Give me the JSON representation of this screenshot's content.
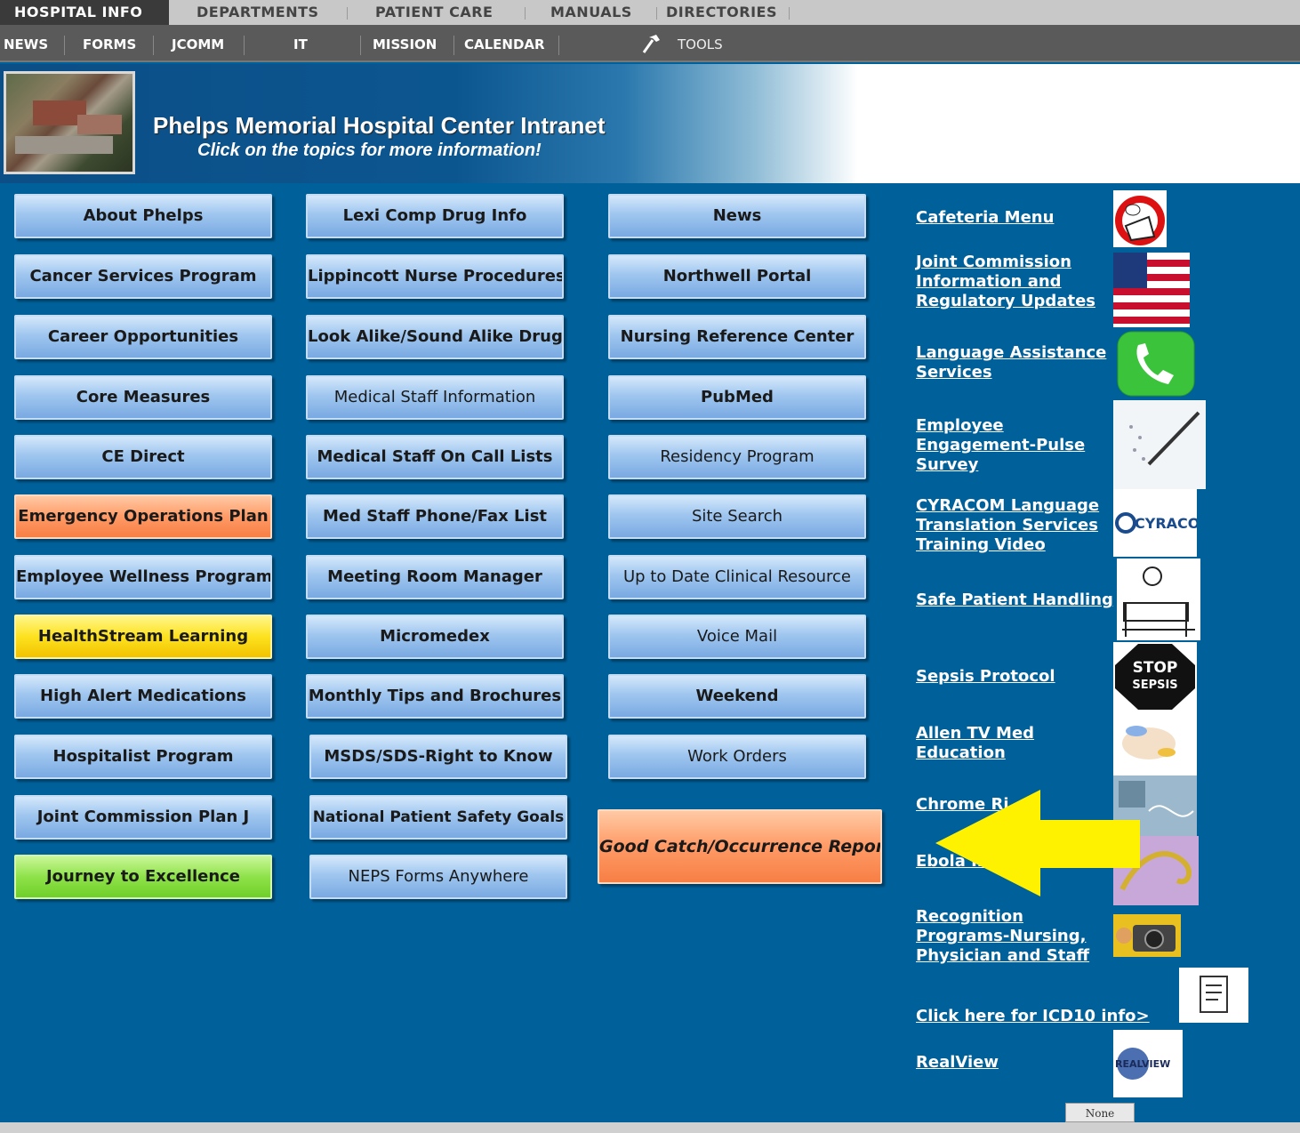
{
  "nav_primary": [
    "HOSPITAL INFO",
    "DEPARTMENTS",
    "PATIENT CARE",
    "MANUALS",
    "DIRECTORIES"
  ],
  "nav_secondary": [
    "NEWS",
    "FORMS",
    "JCOMM",
    "IT",
    "MISSION",
    "CALENDAR",
    "TOOLS"
  ],
  "banner": {
    "title": "Phelps Memorial Hospital Center Intranet",
    "subtitle": "Click on the topics for more information!"
  },
  "col1": [
    "About Phelps",
    "Cancer Services Program",
    "Career Opportunities",
    "Core Measures",
    "CE Direct",
    "Emergency Operations Plan",
    "Employee Wellness Program",
    "HealthStream Learning",
    "High Alert Medications",
    "Hospitalist Program",
    "Joint Commission Plan J",
    "Journey to Excellence"
  ],
  "col2": [
    "Lexi Comp Drug Info",
    "Lippincott Nurse Procedures",
    "Look Alike/Sound Alike Drugs",
    "Medical Staff Information",
    "Medical Staff On Call Lists",
    "Med Staff Phone/Fax List",
    "Meeting Room Manager",
    "Micromedex",
    "Monthly Tips and Brochures",
    "MSDS/SDS-Right to Know",
    "National Patient Safety Goals",
    "NEPS Forms Anywhere"
  ],
  "col3": [
    "News",
    "Northwell Portal",
    "Nursing Reference Center",
    "PubMed",
    "Residency Program",
    "Site Search",
    "Up to Date Clinical Resource",
    "Voice Mail",
    "Weekend",
    "Work Orders"
  ],
  "big_button": "Good Catch/Occurrence Report",
  "right_links": [
    "Cafeteria Menu",
    "Joint Commission Information and Regulatory Updates",
    "Language Assistance Services",
    "Employee Engagement-Pulse Survey",
    "CYRACOM Language Translation Services Training Video",
    "Safe Patient Handling",
    "Sepsis Protocol",
    "Allen TV Med Education",
    "Chrome Ri",
    "Ebola Informatio",
    "Recognition Programs-Nursing, Physician and Staff",
    "Click here for ICD10 info>",
    "RealView"
  ],
  "icons": {
    "stop_top": "STOP",
    "stop_bottom": "SEPSIS",
    "cyracom": "CYRACOM",
    "realview": "REALVIEW"
  },
  "footer_tab": "None"
}
